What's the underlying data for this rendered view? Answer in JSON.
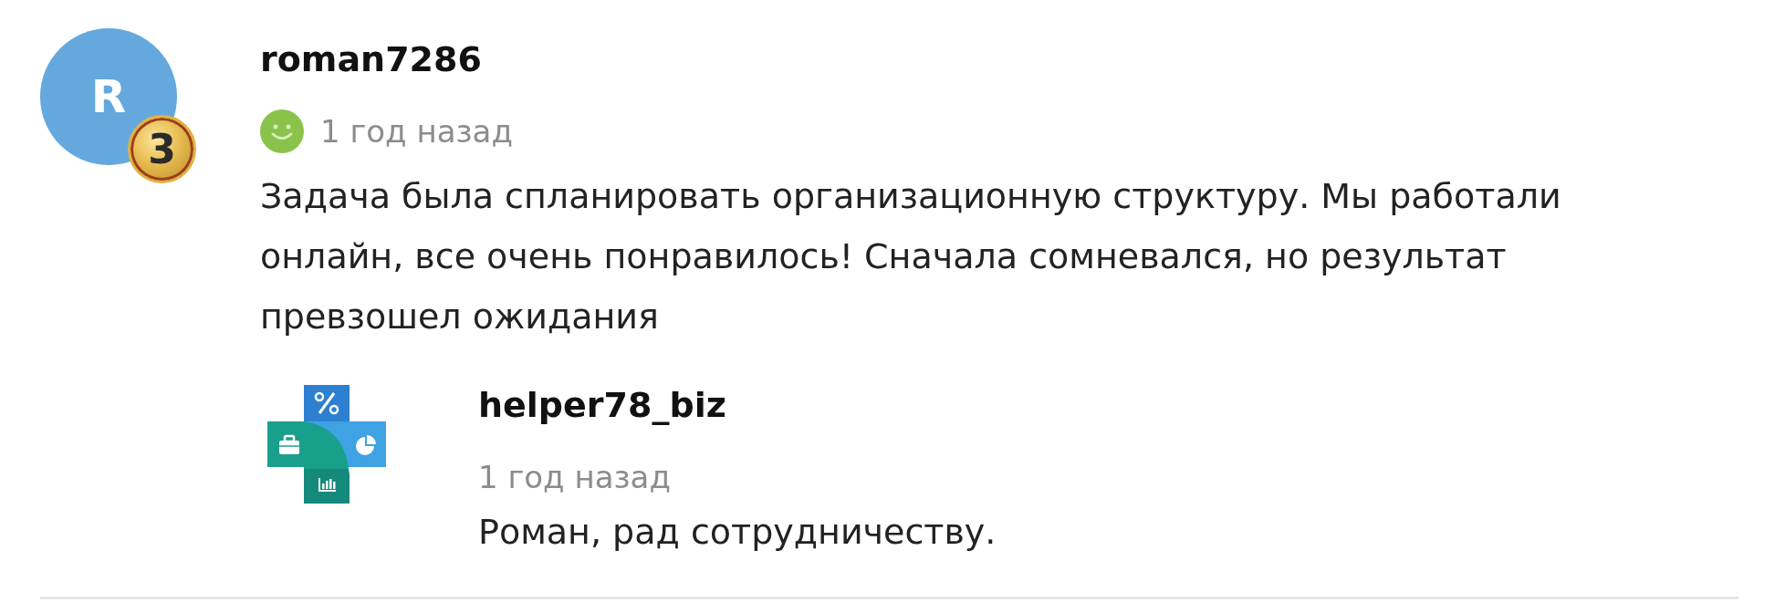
{
  "comment": {
    "avatar": {
      "initial": "R",
      "badge": "3"
    },
    "author": "roman7286",
    "time": "1 год назад",
    "text": "Задача была спланировать организационную структуру. Мы работали онлайн, все очень понравилось! Сначала сомневался, но результат превзошел ожидания",
    "replies": [
      {
        "author": "helper78_biz",
        "time": "1 год назад",
        "text": "Роман, рад сотрудничеству."
      }
    ]
  }
}
